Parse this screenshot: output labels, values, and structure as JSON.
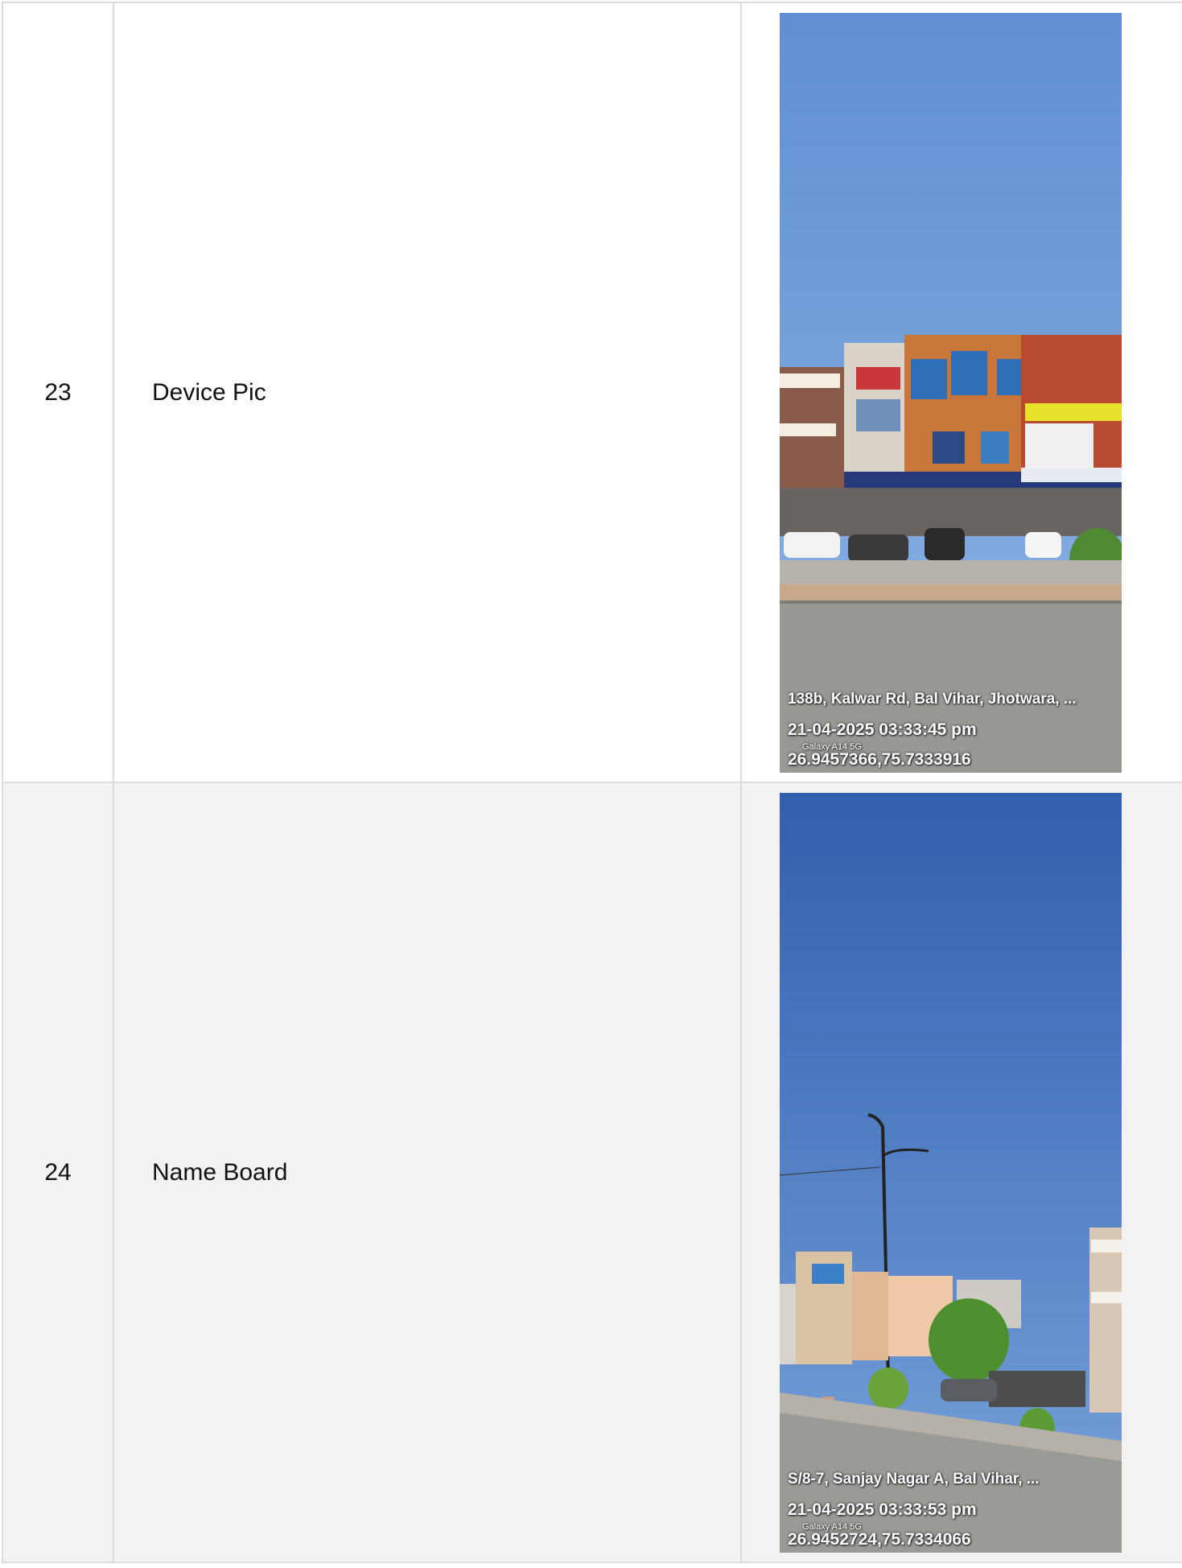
{
  "rows": [
    {
      "number": "23",
      "label": "Device Pic",
      "photo": {
        "address": "138b, Kalwar Rd, Bal Vihar, Jhotwara, ...",
        "datetime": "21-04-2025 03:33:45 pm",
        "device": "Galaxy A14 5G",
        "coordinates": "26.9457366,75.7333916"
      }
    },
    {
      "number": "24",
      "label": "Name Board",
      "photo": {
        "address": "S/8-7, Sanjay Nagar A, Bal Vihar, ...",
        "datetime": "21-04-2025 03:33:53 pm",
        "device": "Galaxy A14 5G",
        "coordinates": "26.9452724,75.7334066"
      }
    }
  ],
  "colors": {
    "row_alt_background": "#f2f2f2",
    "border": "#dddddd",
    "sky_top": "#5b8ccf",
    "sky_bottom_dark": "#2f63b0"
  }
}
